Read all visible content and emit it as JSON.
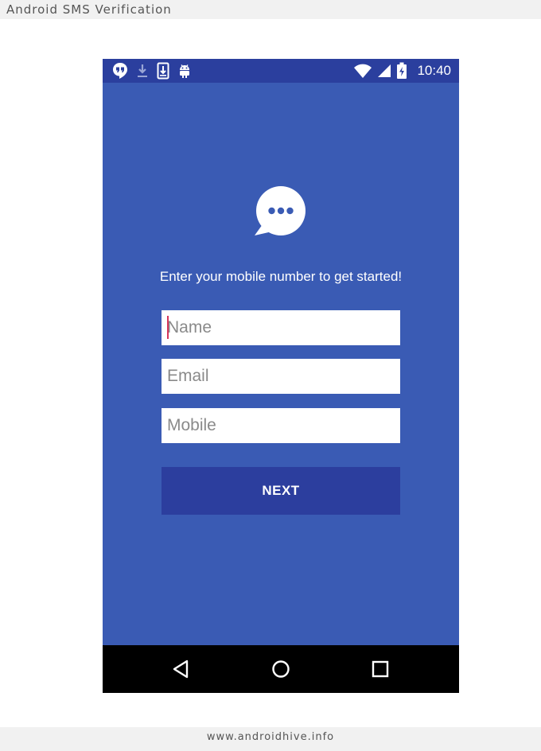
{
  "page": {
    "header_title": "Android SMS Verification",
    "footer_text": "www.androidhive.info"
  },
  "status_bar": {
    "time": "10:40",
    "left_icons": [
      "hangouts-icon",
      "download-icon",
      "download-complete-icon",
      "android-icon"
    ],
    "right_icons": [
      "wifi-icon",
      "signal-icon",
      "battery-charging-icon"
    ]
  },
  "app": {
    "logo_icon": "chat-bubble-icon",
    "prompt": "Enter your mobile number to get started!",
    "fields": {
      "name_placeholder": "Name",
      "email_placeholder": "Email",
      "mobile_placeholder": "Mobile"
    },
    "next_label": "NEXT"
  },
  "nav_bar": {
    "buttons": [
      "back-icon",
      "home-icon",
      "recents-icon"
    ]
  },
  "colors": {
    "background": "#3a5bb4",
    "status_bar": "#2b3f9e",
    "button": "#2c3e9e",
    "cursor": "#d6365b"
  }
}
